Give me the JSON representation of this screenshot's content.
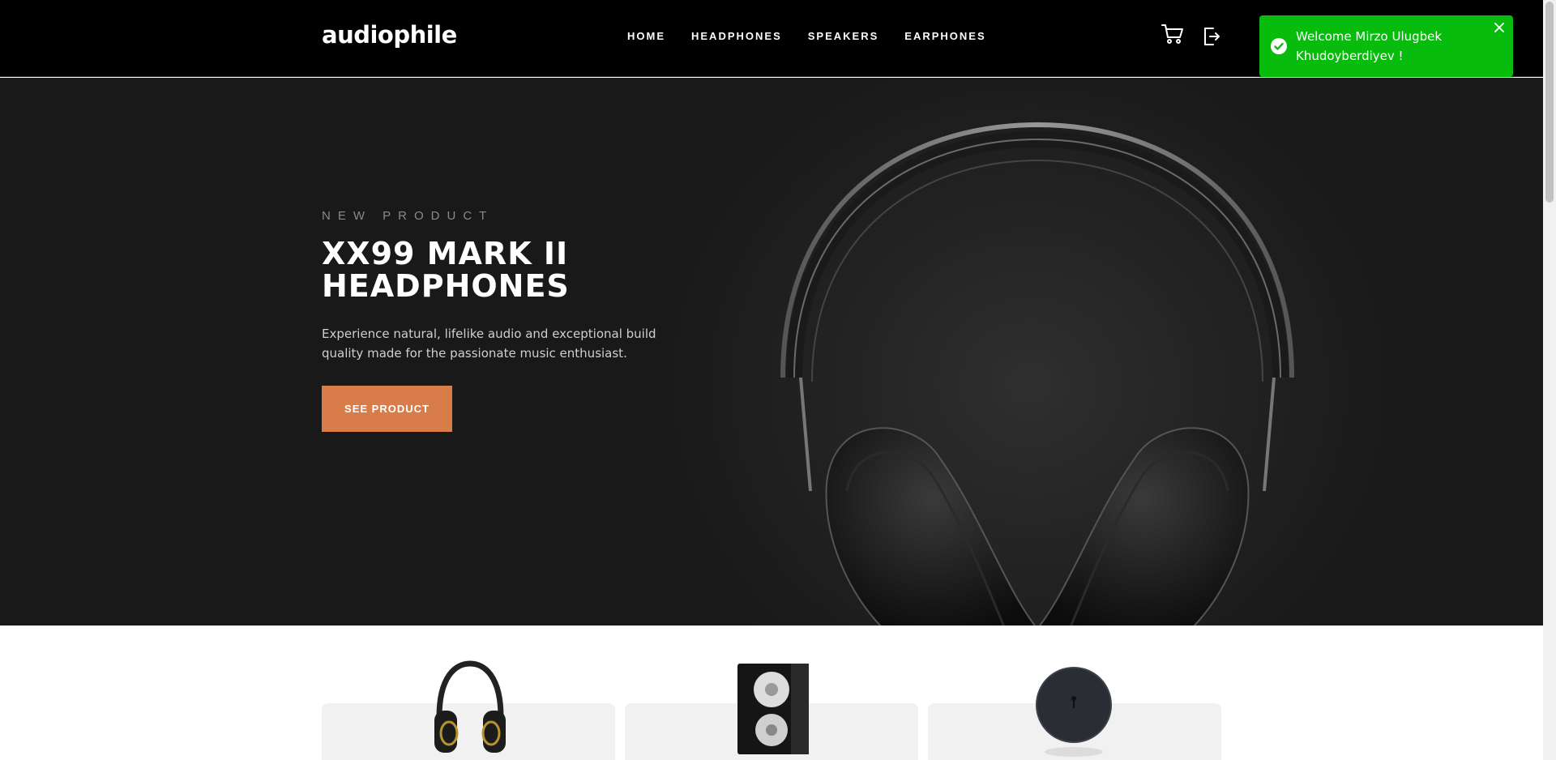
{
  "brand": {
    "logo_text": "audiophile"
  },
  "nav": {
    "items": [
      {
        "label": "HOME"
      },
      {
        "label": "HEADPHONES"
      },
      {
        "label": "SPEAKERS"
      },
      {
        "label": "EARPHONES"
      }
    ],
    "icons": [
      "cart-icon",
      "logout-icon"
    ]
  },
  "toast": {
    "message": "Welcome Mirzo Ulugbek Khudoyberdiyev !",
    "type": "success",
    "color": "#07bc0c"
  },
  "hero": {
    "eyebrow": "NEW PRODUCT",
    "title": "XX99 MARK II HEADPHONES",
    "description": "Experience natural, lifelike audio and exceptional build quality made for the passionate music enthusiast.",
    "cta_label": "SEE PRODUCT",
    "accent_color": "#d87d4a"
  },
  "categories": [
    {
      "icon": "headphones-icon"
    },
    {
      "icon": "speaker-icon"
    },
    {
      "icon": "earphones-icon"
    }
  ]
}
